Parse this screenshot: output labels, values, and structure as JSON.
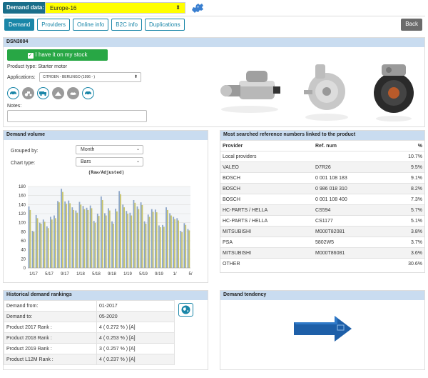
{
  "topbar": {
    "label": "Demand data:",
    "selected": "Europe-16"
  },
  "tabs": [
    "Demand",
    "Providers",
    "Online info",
    "B2C info",
    "Duplications"
  ],
  "back_label": "Back",
  "product": {
    "code": "DSN3004",
    "stock_button": "I have it on my stock",
    "product_type": "Product type: Starter motor",
    "applications_label": "Applications:",
    "applications_value": "CITROEN - BERLINGO (1996 - )",
    "notes_label": "Notes:",
    "vehicle_icons": [
      "car-icon",
      "tractor-icon",
      "truck-icon",
      "motorcycle-icon",
      "boat-icon",
      "bus-icon"
    ]
  },
  "demand_volume": {
    "title": "Demand volume",
    "grouped_label": "Grouped by:",
    "grouped_value": "Month",
    "chart_type_label": "Chart type:",
    "chart_type_value": "Bars"
  },
  "chart_data": {
    "type": "bar",
    "title": "(Raw/Adjusted)",
    "ylim": [
      0,
      180
    ],
    "yticks": [
      "0",
      "20",
      "40",
      "60",
      "80",
      "100",
      "120",
      "140",
      "160",
      "180"
    ],
    "xticks": [
      "1/17",
      "5/17",
      "9/17",
      "1/18",
      "5/18",
      "9/18",
      "1/19",
      "5/19",
      "9/19",
      "1/",
      "5/"
    ],
    "colors": {
      "raw": "#8da6c8",
      "adjusted": "#c8c46a"
    },
    "series": [
      {
        "values": [
          136,
          82,
          117,
          100,
          107,
          92,
          113,
          116,
          148,
          175,
          147,
          149,
          134,
          127,
          146,
          137,
          133,
          138,
          104,
          120,
          158,
          121,
          132,
          103,
          131,
          170,
          140,
          126,
          122,
          150,
          136,
          145,
          103,
          118,
          130,
          129,
          94,
          95,
          134,
          121,
          113,
          110,
          82,
          99,
          86
        ]
      },
      {
        "values": [
          128,
          80,
          110,
          98,
          102,
          88,
          107,
          110,
          145,
          168,
          142,
          143,
          128,
          122,
          140,
          130,
          128,
          132,
          100,
          115,
          150,
          116,
          127,
          98,
          125,
          163,
          134,
          120,
          116,
          144,
          130,
          139,
          98,
          113,
          124,
          123,
          90,
          91,
          128,
          116,
          108,
          105,
          79,
          95,
          83
        ]
      }
    ]
  },
  "most_searched": {
    "title": "Most searched reference numbers linked to the product",
    "columns": [
      "Provider",
      "Ref. num",
      "%"
    ],
    "rows": [
      [
        "Local providers",
        "",
        "10.7%"
      ],
      [
        "VALEO",
        "D7R26",
        "9.5%"
      ],
      [
        "BOSCH",
        "0 001 108 183",
        "9.1%"
      ],
      [
        "BOSCH",
        "0 986 018 310",
        "8.2%"
      ],
      [
        "BOSCH",
        "0 001 108 400",
        "7.3%"
      ],
      [
        "HC-PARTS / HELLA",
        "CS594",
        "5.7%"
      ],
      [
        "HC-PARTS / HELLA",
        "CS1177",
        "5.1%"
      ],
      [
        "MITSUBISHI",
        "M000T82081",
        "3.8%"
      ],
      [
        "PSA",
        "5802W5",
        "3.7%"
      ],
      [
        "MITSUBISHI",
        "M000T86081",
        "3.6%"
      ],
      [
        "OTHER",
        "",
        "30.6%"
      ]
    ]
  },
  "historical": {
    "title": "Historical demand rankings",
    "rows": [
      [
        "Demand from:",
        "01-2017"
      ],
      [
        "Demand to:",
        "05-2020"
      ],
      [
        "Product 2017 Rank :",
        "4 ( 0.272 % ) [A]"
      ],
      [
        "Product 2018 Rank :",
        "4 ( 0.253 % ) [A]"
      ],
      [
        "Product 2019 Rank :",
        "3 ( 0.257 % ) [A]"
      ],
      [
        "Product L12M Rank :",
        "4 ( 0.237 % ) [A]"
      ]
    ]
  },
  "tendency": {
    "title": "Demand tendency"
  }
}
